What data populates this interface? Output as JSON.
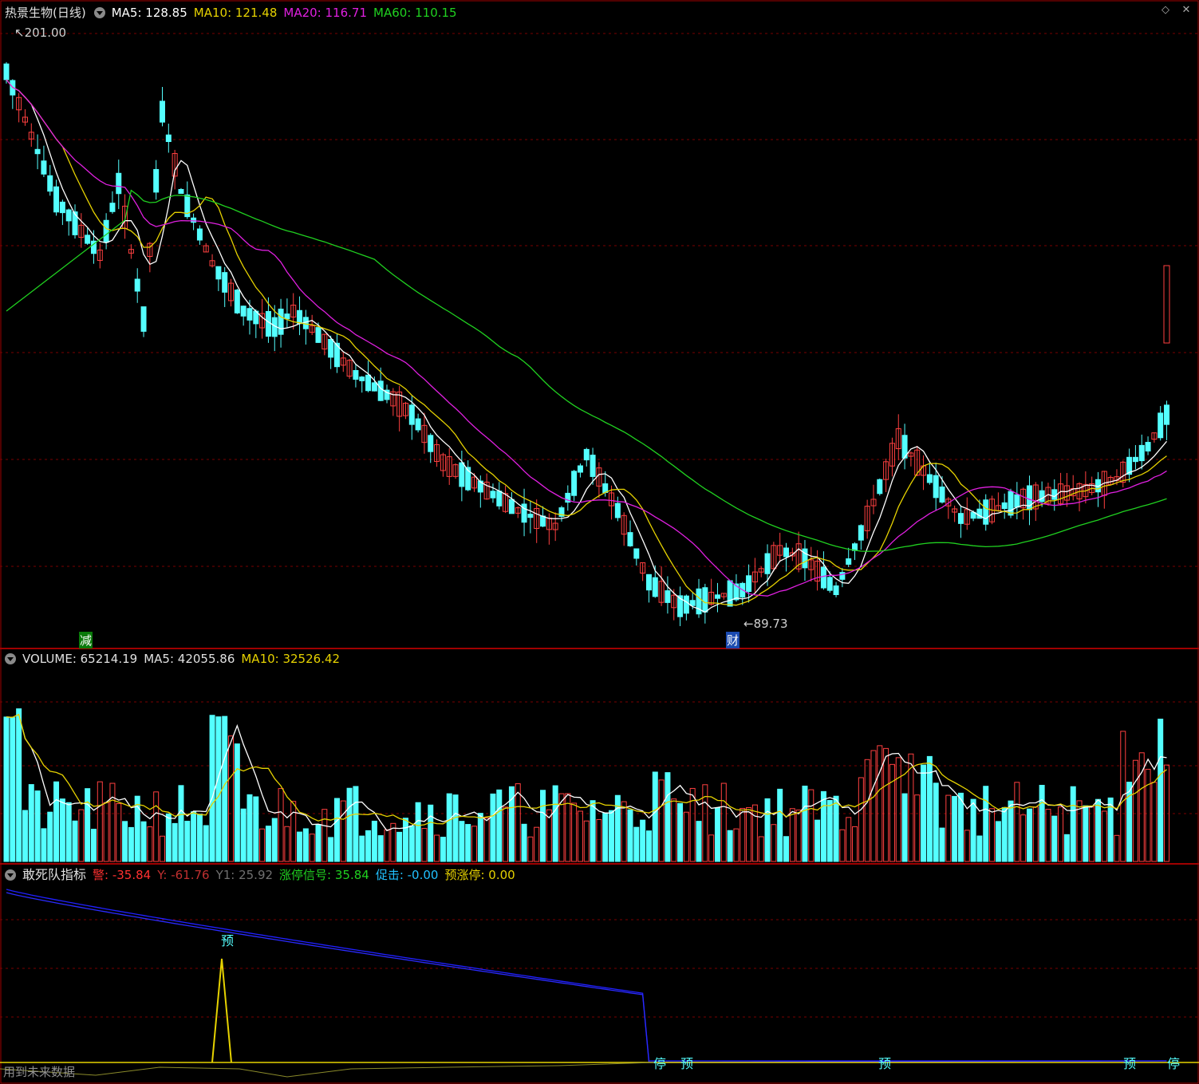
{
  "header": {
    "stock_name": "热景生物(日线)",
    "ma5": "MA5: 128.85",
    "ma10": "MA10: 121.48",
    "ma20": "MA20: 116.71",
    "ma60": "MA60: 110.15",
    "high_label": "201.00",
    "low_label": "89.73",
    "badge_reduce": "减",
    "badge_finance": "财"
  },
  "volume_header": {
    "volume": "VOLUME: 65214.19",
    "ma5": "MA5: 42055.86",
    "ma10": "MA10: 32526.42"
  },
  "indicator_header": {
    "name": "敢死队指标",
    "warn": "警: -35.84",
    "y": "Y: -61.76",
    "y1": "Y1: 25.92",
    "limit_signal": "涨停信号: 35.84",
    "push": "促击: -0.00",
    "pre_limit": "预涨停: 0.00",
    "sig_pre": "预",
    "sig_stop": "停",
    "footer": "用到未来数据"
  },
  "window": {
    "restore_icon": "diamond-icon",
    "close_icon": "close-icon"
  },
  "colors": {
    "up": "#ff4040",
    "down": "#54ffff",
    "ma5": "#ffffff",
    "ma10": "#e6d200",
    "ma20": "#e020e0",
    "ma60": "#20d020",
    "grid": "#7a0000",
    "border": "#a00000",
    "blue": "#2020ff"
  },
  "chart_data": [
    {
      "type": "candlestick",
      "title": "热景生物(日线)",
      "high_marker": 201.0,
      "low_marker": 89.73,
      "ylim": [
        88,
        205
      ],
      "series": [
        {
          "name": "MA5",
          "last": 128.85
        },
        {
          "name": "MA10",
          "last": 121.48
        },
        {
          "name": "MA20",
          "last": 116.71
        },
        {
          "name": "MA60",
          "last": 110.15
        }
      ]
    },
    {
      "type": "bar",
      "series": [
        {
          "name": "VOLUME",
          "last": 65214.19
        },
        {
          "name": "MA5",
          "last": 42055.86
        },
        {
          "name": "MA10",
          "last": 32526.42
        }
      ]
    },
    {
      "type": "line",
      "title": "敢死队指标",
      "series": [
        {
          "name": "警",
          "last": -35.84
        },
        {
          "name": "Y",
          "last": -61.76
        },
        {
          "name": "Y1",
          "last": 25.92
        },
        {
          "name": "涨停信号",
          "last": 35.84
        },
        {
          "name": "促击",
          "last": -0.0
        },
        {
          "name": "预涨停",
          "last": 0.0
        }
      ]
    }
  ]
}
